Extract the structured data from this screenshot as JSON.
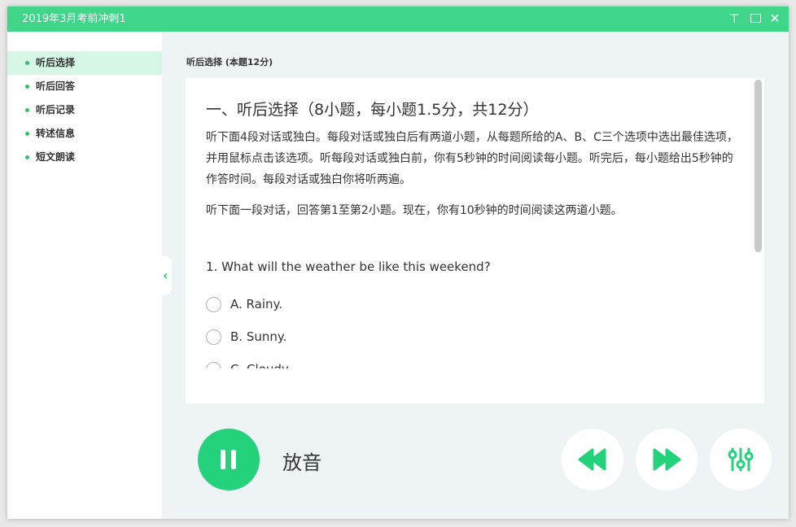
{
  "window": {
    "title": "2019年3月考前冲刺1"
  },
  "sidebar": {
    "items": [
      {
        "label": "听后选择",
        "active": true
      },
      {
        "label": "听后回答",
        "active": false
      },
      {
        "label": "听后记录",
        "active": false
      },
      {
        "label": "转述信息",
        "active": false
      },
      {
        "label": "短文朗读",
        "active": false
      }
    ]
  },
  "main": {
    "section_label": "听后选择 (本题12分)",
    "heading": "一、听后选择（8小题，每小题1.5分，共12分）",
    "instructions": "听下面4段对话或独白。每段对话或独白后有两道小题，从每题所给的A、B、C三个选项中选出最佳选项，并用鼠标点击该选项。听每段对话或独白前，你有5秒钟的时间阅读每小题。听完后，每小题给出5秒钟的作答时间。每段对话或独白你将听两遍。",
    "sub_instructions": "听下面一段对话，回答第1至第2小题。现在，你有10秒钟的时间阅读这两道小题。",
    "question": "1. What will the weather be like this weekend?",
    "options": [
      "A. Rainy.",
      "B. Sunny.",
      "C. Cloudy."
    ]
  },
  "player": {
    "play_label": "放音",
    "accent_color": "#25d27c"
  },
  "colors": {
    "titlebar": "#3fd68a",
    "active_nav_bg": "#d7f7e6"
  }
}
